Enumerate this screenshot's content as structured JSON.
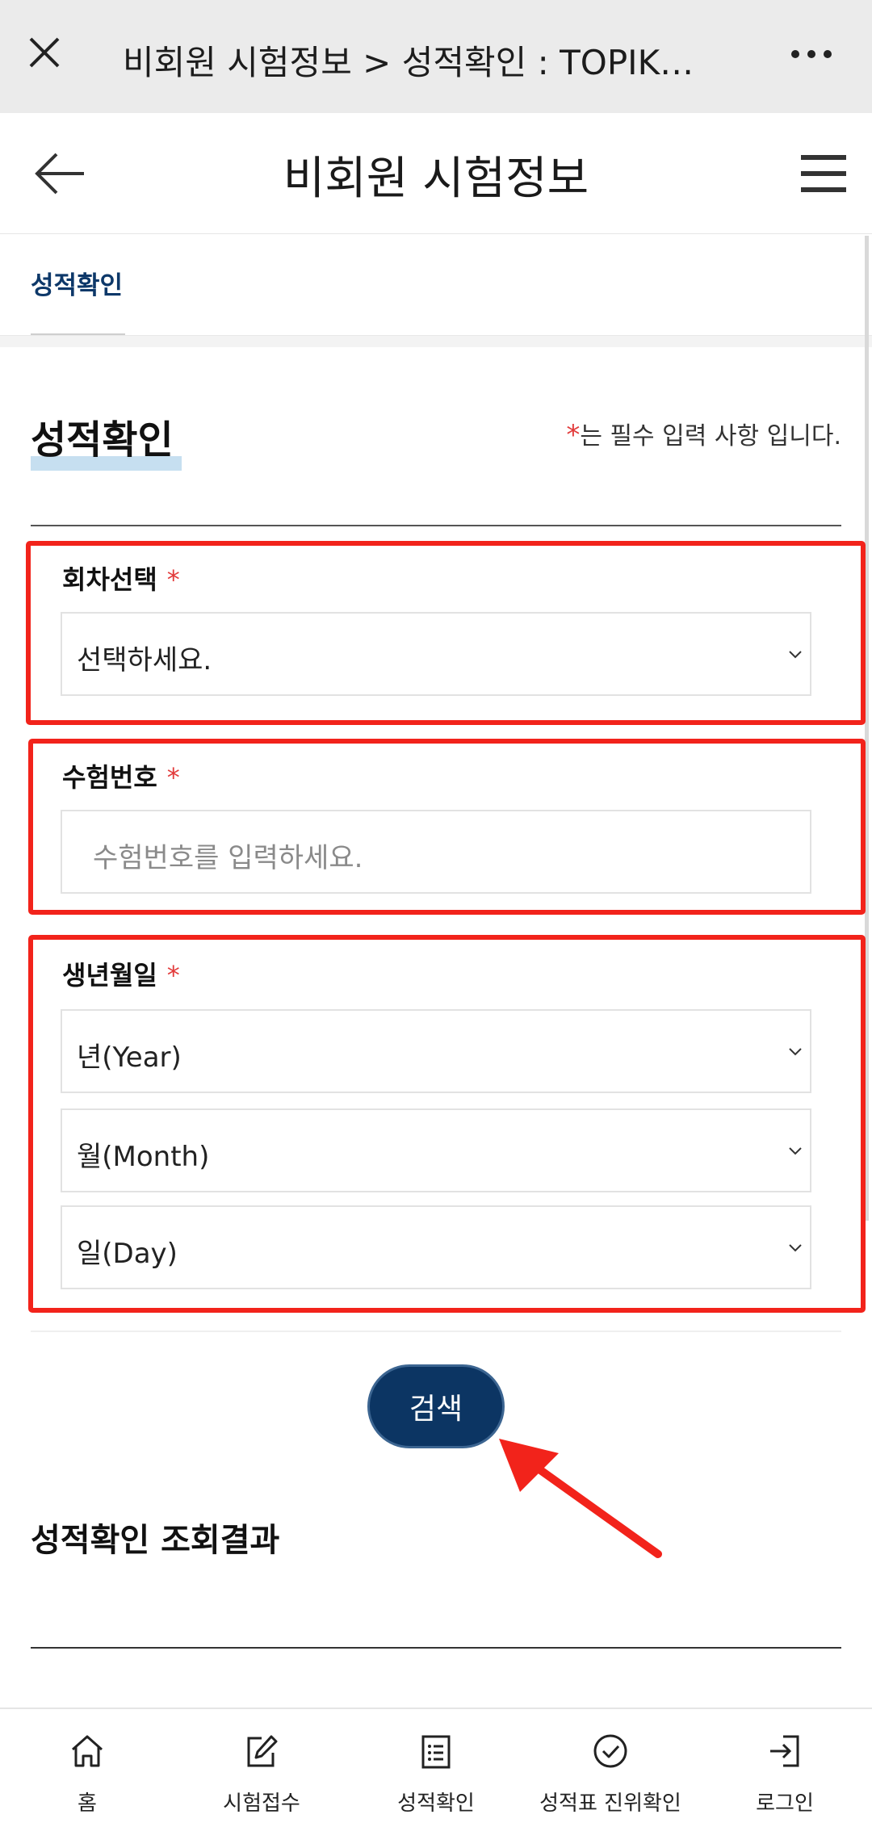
{
  "browser": {
    "title": "비회원 시험정보 > 성적확인 : TOPIK…"
  },
  "header": {
    "title": "비회원 시험정보"
  },
  "subtab": {
    "label": "성적확인"
  },
  "section": {
    "title": "성적확인",
    "required_star": "*",
    "required_note": "는 필수 입력 사항 입니다."
  },
  "form": {
    "round": {
      "label": "회차선택",
      "required": "*",
      "selected": "선택하세요."
    },
    "exam_number": {
      "label": "수험번호",
      "required": "*",
      "placeholder": "수험번호를 입력하세요."
    },
    "birth": {
      "label": "생년월일",
      "required": "*",
      "year": "년(Year)",
      "month": "월(Month)",
      "day": "일(Day)"
    },
    "search_label": "검색"
  },
  "result": {
    "title": "성적확인 조회결과"
  },
  "bottom_nav": [
    {
      "label": "홈",
      "icon": "home-icon"
    },
    {
      "label": "시험접수",
      "icon": "edit-icon"
    },
    {
      "label": "성적확인",
      "icon": "list-document-icon"
    },
    {
      "label": "성적표 진위확인",
      "icon": "check-circle-icon"
    },
    {
      "label": "로그인",
      "icon": "login-icon"
    }
  ],
  "colors": {
    "accent": "#0c3563",
    "highlight": "#f2231b",
    "required": "#e23b3b"
  }
}
